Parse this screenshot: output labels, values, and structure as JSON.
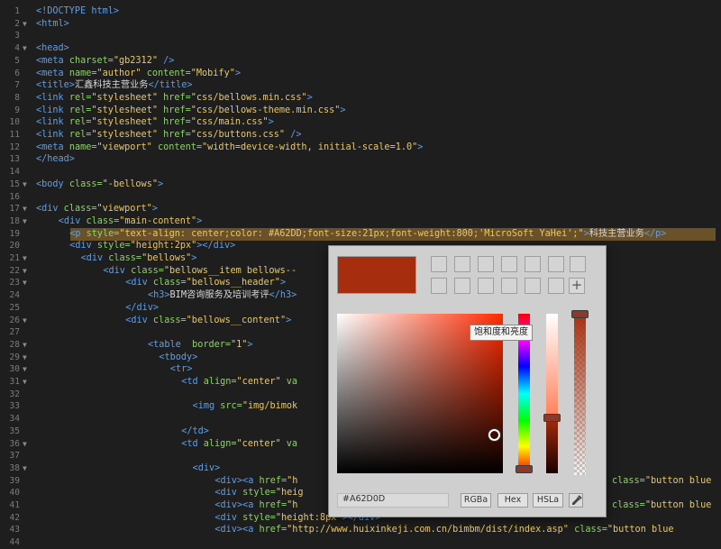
{
  "editor": {
    "lines": [
      {
        "n": "1",
        "fold": "",
        "indent": 0,
        "parts": [
          [
            "t",
            "<!DOCTYPE html>"
          ]
        ]
      },
      {
        "n": "2",
        "fold": "▼",
        "indent": 0,
        "parts": [
          [
            "t",
            "<html>"
          ]
        ]
      },
      {
        "n": "3",
        "fold": "",
        "indent": 0,
        "parts": []
      },
      {
        "n": "4",
        "fold": "▼",
        "indent": 0,
        "parts": [
          [
            "t",
            "<head>"
          ]
        ]
      },
      {
        "n": "5",
        "fold": "",
        "indent": 0,
        "parts": [
          [
            "t",
            "<meta "
          ],
          [
            "a",
            "charset="
          ],
          [
            "v",
            "\"gb2312\""
          ],
          [
            "t",
            " />"
          ]
        ]
      },
      {
        "n": "6",
        "fold": "",
        "indent": 0,
        "parts": [
          [
            "t",
            "<meta "
          ],
          [
            "a",
            "name="
          ],
          [
            "v",
            "\"author\""
          ],
          [
            "a",
            " content="
          ],
          [
            "v",
            "\"Mobify\""
          ],
          [
            "t",
            ">"
          ]
        ]
      },
      {
        "n": "7",
        "fold": "",
        "indent": 0,
        "parts": [
          [
            "t",
            "<title>"
          ],
          [
            "x",
            "汇鑫科技主营业务"
          ],
          [
            "t",
            "</title>"
          ]
        ]
      },
      {
        "n": "8",
        "fold": "",
        "indent": 0,
        "parts": [
          [
            "t",
            "<link "
          ],
          [
            "a",
            "rel="
          ],
          [
            "v",
            "\"stylesheet\""
          ],
          [
            "a",
            " href="
          ],
          [
            "v",
            "\"css/bellows.min.css\""
          ],
          [
            "t",
            ">"
          ]
        ]
      },
      {
        "n": "9",
        "fold": "",
        "indent": 0,
        "parts": [
          [
            "t",
            "<link "
          ],
          [
            "a",
            "rel="
          ],
          [
            "v",
            "\"stylesheet\""
          ],
          [
            "a",
            " href="
          ],
          [
            "v",
            "\"css/bellows-theme.min.css\""
          ],
          [
            "t",
            ">"
          ]
        ]
      },
      {
        "n": "10",
        "fold": "",
        "indent": 0,
        "parts": [
          [
            "t",
            "<link "
          ],
          [
            "a",
            "rel="
          ],
          [
            "v",
            "\"stylesheet\""
          ],
          [
            "a",
            " href="
          ],
          [
            "v",
            "\"css/main.css\""
          ],
          [
            "t",
            ">"
          ]
        ]
      },
      {
        "n": "11",
        "fold": "",
        "indent": 0,
        "parts": [
          [
            "t",
            "<link "
          ],
          [
            "a",
            "rel="
          ],
          [
            "v",
            "\"stylesheet\""
          ],
          [
            "a",
            " href="
          ],
          [
            "v",
            "\"css/buttons.css\""
          ],
          [
            "t",
            " />"
          ]
        ]
      },
      {
        "n": "12",
        "fold": "",
        "indent": 0,
        "parts": [
          [
            "t",
            "<meta "
          ],
          [
            "a",
            "name="
          ],
          [
            "v",
            "\"viewport\""
          ],
          [
            "a",
            " content="
          ],
          [
            "v",
            "\"width=device-width, initial-scale=1.0\""
          ],
          [
            "t",
            ">"
          ]
        ]
      },
      {
        "n": "13",
        "fold": "",
        "indent": 0,
        "parts": [
          [
            "t",
            "</head>"
          ]
        ]
      },
      {
        "n": "14",
        "fold": "",
        "indent": 0,
        "parts": []
      },
      {
        "n": "15",
        "fold": "▼",
        "indent": 0,
        "parts": [
          [
            "t",
            "<body "
          ],
          [
            "a",
            "class="
          ],
          [
            "v",
            "\"-bellows\""
          ],
          [
            "t",
            ">"
          ]
        ]
      },
      {
        "n": "16",
        "fold": "",
        "indent": 0,
        "parts": []
      },
      {
        "n": "17",
        "fold": "▼",
        "indent": 0,
        "parts": [
          [
            "t",
            "<div "
          ],
          [
            "a",
            "class="
          ],
          [
            "v",
            "\"viewport\""
          ],
          [
            "t",
            ">"
          ]
        ]
      },
      {
        "n": "18",
        "fold": "▼",
        "indent": 4,
        "parts": [
          [
            "t",
            "<div "
          ],
          [
            "a",
            "class="
          ],
          [
            "v",
            "\"main-content\""
          ],
          [
            "t",
            ">"
          ]
        ]
      },
      {
        "n": "19",
        "fold": "",
        "indent": 6,
        "hl": true,
        "parts": [
          [
            "t",
            "<p "
          ],
          [
            "a",
            "style="
          ],
          [
            "v",
            "\"text-align: center;color: #A62DD;font-size:21px;font-weight:800;'MicroSoft YaHei';\""
          ],
          [
            "t",
            ">"
          ],
          [
            "x",
            "科技主营业务"
          ],
          [
            "t",
            "</p>"
          ]
        ]
      },
      {
        "n": "20",
        "fold": "",
        "indent": 6,
        "parts": [
          [
            "t",
            "<div "
          ],
          [
            "a",
            "style="
          ],
          [
            "v",
            "\"height:2px\""
          ],
          [
            "t",
            "></div>"
          ]
        ]
      },
      {
        "n": "21",
        "fold": "▼",
        "indent": 8,
        "parts": [
          [
            "t",
            "<div "
          ],
          [
            "a",
            "class="
          ],
          [
            "v",
            "\"bellows\""
          ],
          [
            "t",
            ">"
          ]
        ]
      },
      {
        "n": "22",
        "fold": "▼",
        "indent": 12,
        "parts": [
          [
            "t",
            "<div "
          ],
          [
            "a",
            "class="
          ],
          [
            "v",
            "\"bellows__item bellows--"
          ]
        ]
      },
      {
        "n": "23",
        "fold": "▼",
        "indent": 16,
        "parts": [
          [
            "t",
            "<div "
          ],
          [
            "a",
            "class="
          ],
          [
            "v",
            "\"bellows__header\""
          ],
          [
            "t",
            ">"
          ]
        ]
      },
      {
        "n": "24",
        "fold": "",
        "indent": 20,
        "parts": [
          [
            "t",
            "<h3>"
          ],
          [
            "x",
            "BIM咨询服务及培训考评"
          ],
          [
            "t",
            "</h3>"
          ]
        ]
      },
      {
        "n": "25",
        "fold": "",
        "indent": 16,
        "parts": [
          [
            "t",
            "</div>"
          ]
        ]
      },
      {
        "n": "26",
        "fold": "▼",
        "indent": 16,
        "parts": [
          [
            "t",
            "<div "
          ],
          [
            "a",
            "class="
          ],
          [
            "v",
            "\"bellows__content\""
          ],
          [
            "t",
            ">"
          ]
        ]
      },
      {
        "n": "27",
        "fold": "",
        "indent": 0,
        "parts": []
      },
      {
        "n": "28",
        "fold": "▼",
        "indent": 20,
        "parts": [
          [
            "t",
            "<table  "
          ],
          [
            "a",
            "border="
          ],
          [
            "v",
            "\"1\""
          ],
          [
            "t",
            ">"
          ]
        ]
      },
      {
        "n": "29",
        "fold": "▼",
        "indent": 22,
        "parts": [
          [
            "t",
            "<tbody>"
          ]
        ]
      },
      {
        "n": "30",
        "fold": "▼",
        "indent": 24,
        "parts": [
          [
            "t",
            "<tr>"
          ]
        ]
      },
      {
        "n": "31",
        "fold": "▼",
        "indent": 26,
        "parts": [
          [
            "t",
            "<td "
          ],
          [
            "a",
            "align="
          ],
          [
            "v",
            "\"center\""
          ],
          [
            "a",
            " va"
          ]
        ]
      },
      {
        "n": "32",
        "fold": "",
        "indent": 0,
        "parts": []
      },
      {
        "n": "33",
        "fold": "",
        "indent": 28,
        "parts": [
          [
            "t",
            "<img "
          ],
          [
            "a",
            "src="
          ],
          [
            "v",
            "\"img/bimok"
          ]
        ]
      },
      {
        "n": "34",
        "fold": "",
        "indent": 0,
        "parts": []
      },
      {
        "n": "35",
        "fold": "",
        "indent": 26,
        "parts": [
          [
            "t",
            "</td>"
          ]
        ]
      },
      {
        "n": "36",
        "fold": "▼",
        "indent": 26,
        "parts": [
          [
            "t",
            "<td "
          ],
          [
            "a",
            "align="
          ],
          [
            "v",
            "\"center\""
          ],
          [
            "a",
            " va"
          ]
        ]
      },
      {
        "n": "37",
        "fold": "",
        "indent": 0,
        "parts": []
      },
      {
        "n": "38",
        "fold": "▼",
        "indent": 28,
        "parts": [
          [
            "t",
            "<div>"
          ]
        ]
      },
      {
        "n": "39",
        "fold": "",
        "indent": 32,
        "parts": [
          [
            "t",
            "<div><a "
          ],
          [
            "a",
            "href="
          ],
          [
            "v",
            "\"h"
          ]
        ]
      },
      {
        "n": "40",
        "fold": "",
        "indent": 32,
        "parts": [
          [
            "t",
            "<div "
          ],
          [
            "a",
            "style="
          ],
          [
            "v",
            "\"heig"
          ]
        ]
      },
      {
        "n": "41",
        "fold": "",
        "indent": 32,
        "parts": [
          [
            "t",
            "<div><a "
          ],
          [
            "a",
            "href="
          ],
          [
            "v",
            "\"h"
          ]
        ]
      },
      {
        "n": "42",
        "fold": "",
        "indent": 32,
        "parts": [
          [
            "t",
            "<div "
          ],
          [
            "a",
            "style="
          ],
          [
            "v",
            "\"height:8px\""
          ],
          [
            "t",
            "></div>"
          ]
        ]
      },
      {
        "n": "43",
        "fold": "",
        "indent": 32,
        "parts": [
          [
            "t",
            "<div><a "
          ],
          [
            "a",
            "href="
          ],
          [
            "v",
            "\"http://www.huixinkeji.com.cn/bimbm/dist/index.asp\""
          ],
          [
            "a",
            " class="
          ],
          [
            "v",
            "\"button blue"
          ]
        ]
      },
      {
        "n": "44",
        "fold": "",
        "indent": 0,
        "parts": [
          [
            "t",
            "                      "
          ]
        ]
      }
    ],
    "right_edge_lines": [
      {
        "line": "39",
        "text": "class=\"button blue"
      },
      {
        "line": "41",
        "text": "class=\"button blue"
      }
    ]
  },
  "picker": {
    "current_color": "#A62D0D",
    "tooltip": "饱和度和亮度",
    "hex_value": "#A62D0D",
    "modes": [
      "RGBa",
      "Hex",
      "HSLa"
    ],
    "add_label": "+",
    "colors": {
      "selection": "#6b5128"
    }
  }
}
